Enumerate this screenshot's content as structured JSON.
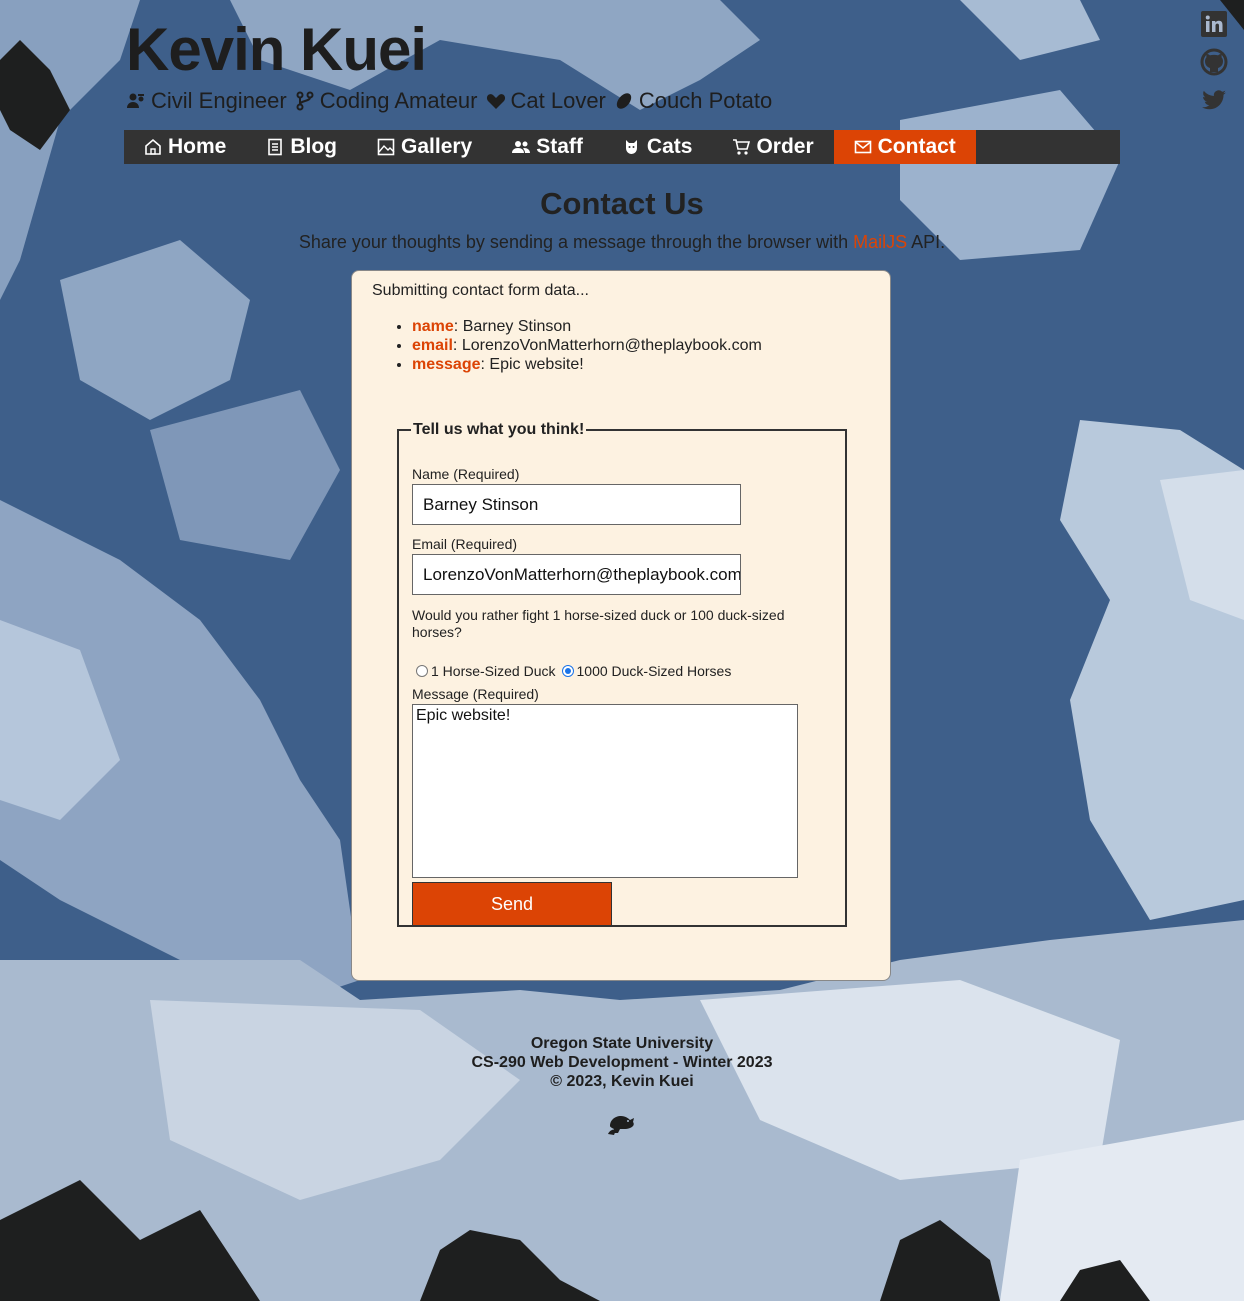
{
  "header": {
    "title": "Kevin Kuei",
    "tags": [
      "Civil Engineer",
      "Coding Amateur",
      "Cat Lover",
      "Couch Potato"
    ]
  },
  "nav": [
    {
      "label": "Home"
    },
    {
      "label": "Blog"
    },
    {
      "label": "Gallery"
    },
    {
      "label": "Staff"
    },
    {
      "label": "Cats"
    },
    {
      "label": "Order"
    },
    {
      "label": "Contact",
      "active": true
    }
  ],
  "social": [
    "linkedin-icon",
    "github-icon",
    "twitter-icon"
  ],
  "page": {
    "title": "Contact Us",
    "subtitle_before": "Share your thoughts by sending a message through the browser with ",
    "subtitle_link": "MailJS",
    "subtitle_after": " API."
  },
  "submission": {
    "status": "Submitting contact form data...",
    "items": [
      {
        "key": "name",
        "value": ": Barney Stinson"
      },
      {
        "key": "email",
        "value": ": LorenzoVonMatterhorn@theplaybook.com"
      },
      {
        "key": "message",
        "value": ": Epic website!"
      }
    ]
  },
  "form": {
    "legend": "Tell us what you think!",
    "name_label": "Name (Required)",
    "name_value": "Barney Stinson",
    "email_label": "Email (Required)",
    "email_value": "LorenzoVonMatterhorn@theplaybook.com",
    "question": "Would you rather fight 1 horse-sized duck or 100 duck-sized horses?",
    "option1": "1 Horse-Sized Duck",
    "option2": "1000 Duck-Sized Horses",
    "selected_option": 2,
    "message_label": "Message (Required)",
    "message_value": "Epic website!",
    "send_label": "Send"
  },
  "footer": {
    "line1": "Oregon State University",
    "line2": "CS-290 Web Development - Winter 2023",
    "line3": "© 2023, Kevin Kuei"
  },
  "colors": {
    "accent": "#dc4405",
    "nav_bg": "#333333",
    "card_bg": "#fdf2e1"
  }
}
